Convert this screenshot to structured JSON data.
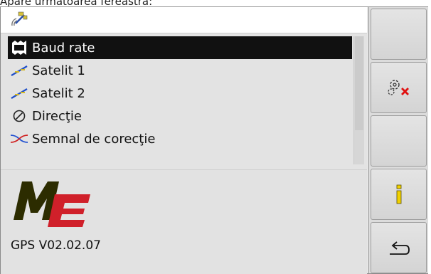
{
  "caption": "Apare următoarea fereastră:",
  "header": {
    "icon": "gps-satellite-icon"
  },
  "menu": {
    "items": [
      {
        "label": "Baud rate",
        "icon": "baud-rate-icon",
        "selected": true
      },
      {
        "label": "Satelit 1",
        "icon": "satellite-signal-icon",
        "selected": false
      },
      {
        "label": "Satelit 2",
        "icon": "satellite-signal-icon",
        "selected": false
      },
      {
        "label": "Direcţie",
        "icon": "direction-icon",
        "selected": false
      },
      {
        "label": "Semnal de corecţie",
        "icon": "correction-signal-icon",
        "selected": false
      }
    ]
  },
  "info": {
    "logo": {
      "icon": "me-logo",
      "letters": "ME",
      "colors": {
        "m": "#2c2c00",
        "e": "#d0202a"
      }
    },
    "version": "GPS V02.02.07"
  },
  "softkeys": [
    {
      "name": "softkey-1",
      "icon": ""
    },
    {
      "name": "softkey-2",
      "icon": "settings-cancel-icon"
    },
    {
      "name": "softkey-3",
      "icon": ""
    },
    {
      "name": "softkey-4",
      "icon": "info-icon"
    },
    {
      "name": "softkey-5",
      "icon": "return-icon"
    }
  ],
  "colors": {
    "selected_bg": "#111111",
    "info_icon": "#f0d000",
    "cancel_x": "#e01010"
  }
}
